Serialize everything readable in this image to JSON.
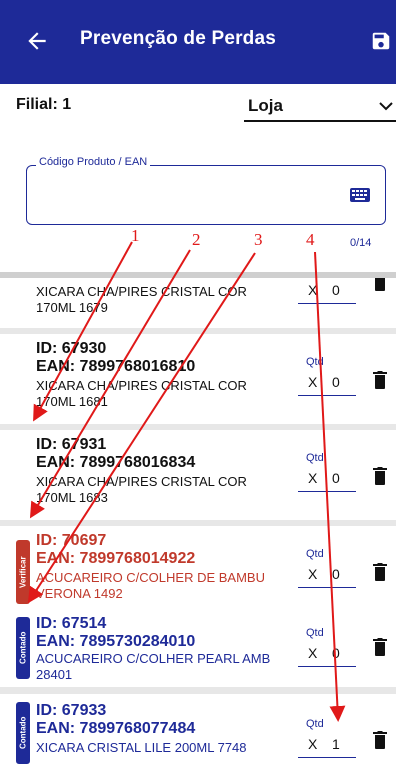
{
  "header": {
    "title": "Prevenção de Perdas",
    "back_icon": "arrow-left-icon",
    "save_icon": "floppy-disk-icon"
  },
  "filter": {
    "filial_label": "Filial: 1",
    "loja_value": "Loja"
  },
  "search": {
    "legend": "Código Produto / EAN",
    "value": "",
    "counter": "0/14"
  },
  "items": [
    {
      "id": "",
      "ean": "",
      "desc1": "XICARA CHA/PIRES CRISTAL COR",
      "desc2": "170ML 1679",
      "qtd_label": "",
      "x": "X",
      "qty": "0",
      "tag": ""
    },
    {
      "id": "ID: 67930",
      "ean": "EAN: 7899768016810",
      "desc1": "XICARA CHA/PIRES CRISTAL COR",
      "desc2": "170ML 1681",
      "qtd_label": "Qtd",
      "x": "X",
      "qty": "0",
      "tag": ""
    },
    {
      "id": "ID: 67931",
      "ean": "EAN: 7899768016834",
      "desc1": "XICARA CHA/PIRES CRISTAL COR",
      "desc2": "170ML 1683",
      "qtd_label": "Qtd",
      "x": "X",
      "qty": "0",
      "tag": ""
    },
    {
      "id": "ID: 70697",
      "ean": "EAN: 7899768014922",
      "desc1": "ACUCAREIRO C/COLHER DE BAMBU",
      "desc2": "VERONA 1492",
      "qtd_label": "Qtd",
      "x": "X",
      "qty": "0",
      "tag": "Verificar"
    },
    {
      "id": "ID: 67514",
      "ean": "EAN: 7895730284010",
      "desc1": "ACUCAREIRO C/COLHER PEARL AMB",
      "desc2": "28401",
      "qtd_label": "Qtd",
      "x": "X",
      "qty": "0",
      "tag": "Contado"
    },
    {
      "id": "ID: 67933",
      "ean": "EAN: 7899768077484",
      "desc1": "XICARA CRISTAL LILE 200ML 7748",
      "desc2": "",
      "qtd_label": "Qtd",
      "x": "X",
      "qty": "1",
      "tag": "Contado"
    }
  ],
  "annotations": [
    "1",
    "2",
    "3",
    "4"
  ],
  "colors": {
    "primary": "#1e2a98",
    "danger": "#c0392b",
    "annotation": "#e01919"
  }
}
